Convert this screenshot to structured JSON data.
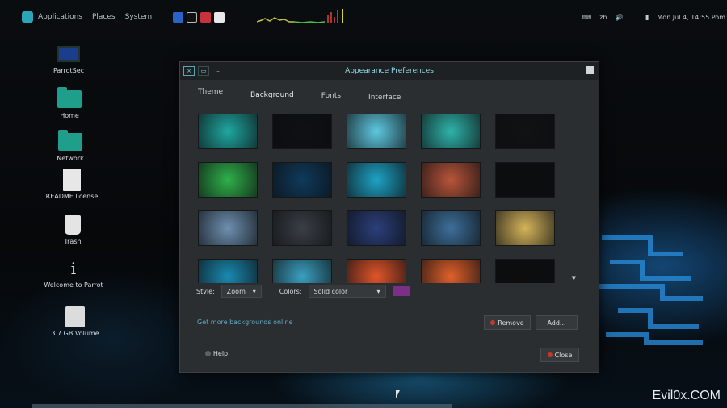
{
  "top_panel": {
    "menus": [
      "Applications",
      "Places",
      "System"
    ],
    "tray": {
      "locale": "zh",
      "clock": "Mon Jul 4, 14:55 Pom"
    }
  },
  "desktop_icons": [
    {
      "label": "ParrotSec",
      "icon": "computer-icon"
    },
    {
      "label": "Home",
      "icon": "home-folder-icon"
    },
    {
      "label": "Network",
      "icon": "network-folder-icon"
    },
    {
      "label": "README.license",
      "icon": "document-icon"
    },
    {
      "label": "Trash",
      "icon": "trash-icon"
    },
    {
      "label": "Welcome to Parrot",
      "icon": "info-icon"
    },
    {
      "label": "3.7 GB Volume",
      "icon": "drive-icon"
    }
  ],
  "window": {
    "title": "Appearance Preferences",
    "tabs": [
      "Theme",
      "Background",
      "Fonts",
      "Interface"
    ],
    "thumbnails": [
      "#1fa7a0",
      "#0e1114",
      "#5ec8e0",
      "#2fb3aa",
      "#101214",
      "#2fb04a",
      "#0f3a5c",
      "#1ea2c4",
      "#b8553a",
      "#0c0d0e",
      "#6e8fb0",
      "#3a3f46",
      "#2b3f7a",
      "#3d6f9a",
      "#d4b45a",
      "#1a8ab0",
      "#3aa0c0",
      "#e0552a",
      "#e0602a",
      "#0d0d0d"
    ],
    "style_label": "Style:",
    "style_value": "Zoom",
    "colors_label": "Colors:",
    "colors_value": "Solid color",
    "swatch_color": "#7b2f86",
    "get_more_link": "Get more backgrounds online",
    "remove_button": "Remove",
    "add_button": "Add...",
    "help_button": "Help",
    "close_button": "Close"
  },
  "watermark": "Evil0x.COM"
}
